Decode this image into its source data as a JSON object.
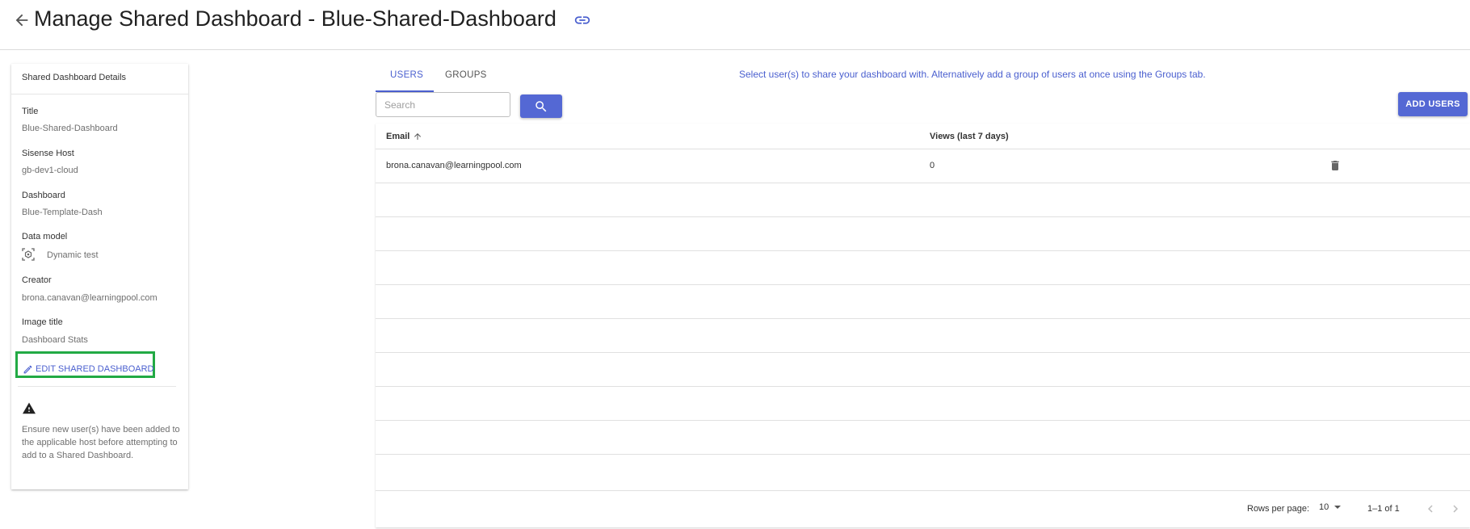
{
  "header": {
    "title": "Manage Shared Dashboard - Blue-Shared-Dashboard"
  },
  "details": {
    "heading": "Shared Dashboard Details",
    "fields": [
      {
        "label": "Title",
        "value": "Blue-Shared-Dashboard"
      },
      {
        "label": "Sisense Host",
        "value": "gb-dev1-cloud"
      },
      {
        "label": "Dashboard",
        "value": "Blue-Template-Dash"
      },
      {
        "label": "Data model",
        "value": "Dynamic test"
      },
      {
        "label": "Creator",
        "value": "brona.canavan@learningpool.com"
      },
      {
        "label": "Image title",
        "value": "Dashboard Stats"
      }
    ],
    "edit_label": "EDIT SHARED DASHBOARD",
    "warning": "Ensure new user(s) have been added to the applicable host before attempting to add to a Shared Dashboard."
  },
  "tabs": [
    {
      "label": "USERS",
      "active": true
    },
    {
      "label": "GROUPS",
      "active": false
    }
  ],
  "help_text": "Select user(s) to share your dashboard with. Alternatively add a group of users at once using the Groups tab.",
  "search": {
    "placeholder": "Search"
  },
  "add_users_label": "ADD USERS",
  "table": {
    "columns": [
      "Email",
      "Views (last 7 days)"
    ],
    "rows": [
      {
        "email": "brona.canavan@learningpool.com",
        "views": "0"
      }
    ]
  },
  "pagination": {
    "rows_per_page_label": "Rows per page:",
    "rows_per_page": "10",
    "range": "1–1 of 1"
  },
  "colors": {
    "accent": "#5468d4",
    "link": "#4a5fcf",
    "highlight_box": "#22aa44"
  },
  "icons": [
    "arrow-left-icon",
    "link-icon",
    "database-icon",
    "pencil-icon",
    "warning-icon",
    "search-icon",
    "arrow-up-icon",
    "trash-icon",
    "dropdown-arrow-icon",
    "chevron-left-icon",
    "chevron-right-icon"
  ]
}
